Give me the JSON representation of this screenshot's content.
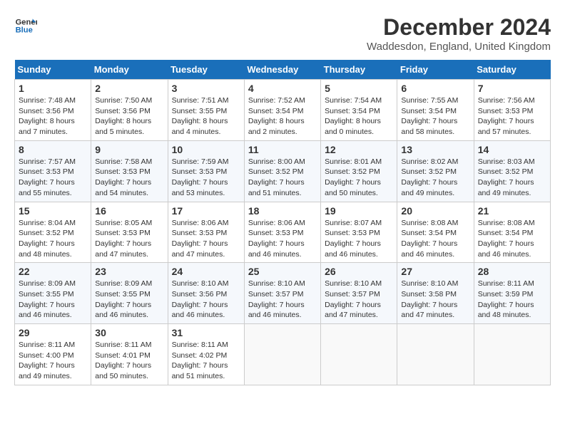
{
  "logo": {
    "text_general": "General",
    "text_blue": "Blue"
  },
  "title": {
    "month_year": "December 2024",
    "location": "Waddesdon, England, United Kingdom"
  },
  "weekdays": [
    "Sunday",
    "Monday",
    "Tuesday",
    "Wednesday",
    "Thursday",
    "Friday",
    "Saturday"
  ],
  "weeks": [
    [
      {
        "day": "1",
        "info": "Sunrise: 7:48 AM\nSunset: 3:56 PM\nDaylight: 8 hours\nand 7 minutes."
      },
      {
        "day": "2",
        "info": "Sunrise: 7:50 AM\nSunset: 3:56 PM\nDaylight: 8 hours\nand 5 minutes."
      },
      {
        "day": "3",
        "info": "Sunrise: 7:51 AM\nSunset: 3:55 PM\nDaylight: 8 hours\nand 4 minutes."
      },
      {
        "day": "4",
        "info": "Sunrise: 7:52 AM\nSunset: 3:54 PM\nDaylight: 8 hours\nand 2 minutes."
      },
      {
        "day": "5",
        "info": "Sunrise: 7:54 AM\nSunset: 3:54 PM\nDaylight: 8 hours\nand 0 minutes."
      },
      {
        "day": "6",
        "info": "Sunrise: 7:55 AM\nSunset: 3:54 PM\nDaylight: 7 hours\nand 58 minutes."
      },
      {
        "day": "7",
        "info": "Sunrise: 7:56 AM\nSunset: 3:53 PM\nDaylight: 7 hours\nand 57 minutes."
      }
    ],
    [
      {
        "day": "8",
        "info": "Sunrise: 7:57 AM\nSunset: 3:53 PM\nDaylight: 7 hours\nand 55 minutes."
      },
      {
        "day": "9",
        "info": "Sunrise: 7:58 AM\nSunset: 3:53 PM\nDaylight: 7 hours\nand 54 minutes."
      },
      {
        "day": "10",
        "info": "Sunrise: 7:59 AM\nSunset: 3:53 PM\nDaylight: 7 hours\nand 53 minutes."
      },
      {
        "day": "11",
        "info": "Sunrise: 8:00 AM\nSunset: 3:52 PM\nDaylight: 7 hours\nand 51 minutes."
      },
      {
        "day": "12",
        "info": "Sunrise: 8:01 AM\nSunset: 3:52 PM\nDaylight: 7 hours\nand 50 minutes."
      },
      {
        "day": "13",
        "info": "Sunrise: 8:02 AM\nSunset: 3:52 PM\nDaylight: 7 hours\nand 49 minutes."
      },
      {
        "day": "14",
        "info": "Sunrise: 8:03 AM\nSunset: 3:52 PM\nDaylight: 7 hours\nand 49 minutes."
      }
    ],
    [
      {
        "day": "15",
        "info": "Sunrise: 8:04 AM\nSunset: 3:52 PM\nDaylight: 7 hours\nand 48 minutes."
      },
      {
        "day": "16",
        "info": "Sunrise: 8:05 AM\nSunset: 3:53 PM\nDaylight: 7 hours\nand 47 minutes."
      },
      {
        "day": "17",
        "info": "Sunrise: 8:06 AM\nSunset: 3:53 PM\nDaylight: 7 hours\nand 47 minutes."
      },
      {
        "day": "18",
        "info": "Sunrise: 8:06 AM\nSunset: 3:53 PM\nDaylight: 7 hours\nand 46 minutes."
      },
      {
        "day": "19",
        "info": "Sunrise: 8:07 AM\nSunset: 3:53 PM\nDaylight: 7 hours\nand 46 minutes."
      },
      {
        "day": "20",
        "info": "Sunrise: 8:08 AM\nSunset: 3:54 PM\nDaylight: 7 hours\nand 46 minutes."
      },
      {
        "day": "21",
        "info": "Sunrise: 8:08 AM\nSunset: 3:54 PM\nDaylight: 7 hours\nand 46 minutes."
      }
    ],
    [
      {
        "day": "22",
        "info": "Sunrise: 8:09 AM\nSunset: 3:55 PM\nDaylight: 7 hours\nand 46 minutes."
      },
      {
        "day": "23",
        "info": "Sunrise: 8:09 AM\nSunset: 3:55 PM\nDaylight: 7 hours\nand 46 minutes."
      },
      {
        "day": "24",
        "info": "Sunrise: 8:10 AM\nSunset: 3:56 PM\nDaylight: 7 hours\nand 46 minutes."
      },
      {
        "day": "25",
        "info": "Sunrise: 8:10 AM\nSunset: 3:57 PM\nDaylight: 7 hours\nand 46 minutes."
      },
      {
        "day": "26",
        "info": "Sunrise: 8:10 AM\nSunset: 3:57 PM\nDaylight: 7 hours\nand 47 minutes."
      },
      {
        "day": "27",
        "info": "Sunrise: 8:10 AM\nSunset: 3:58 PM\nDaylight: 7 hours\nand 47 minutes."
      },
      {
        "day": "28",
        "info": "Sunrise: 8:11 AM\nSunset: 3:59 PM\nDaylight: 7 hours\nand 48 minutes."
      }
    ],
    [
      {
        "day": "29",
        "info": "Sunrise: 8:11 AM\nSunset: 4:00 PM\nDaylight: 7 hours\nand 49 minutes."
      },
      {
        "day": "30",
        "info": "Sunrise: 8:11 AM\nSunset: 4:01 PM\nDaylight: 7 hours\nand 50 minutes."
      },
      {
        "day": "31",
        "info": "Sunrise: 8:11 AM\nSunset: 4:02 PM\nDaylight: 7 hours\nand 51 minutes."
      },
      {
        "day": "",
        "info": ""
      },
      {
        "day": "",
        "info": ""
      },
      {
        "day": "",
        "info": ""
      },
      {
        "day": "",
        "info": ""
      }
    ]
  ]
}
